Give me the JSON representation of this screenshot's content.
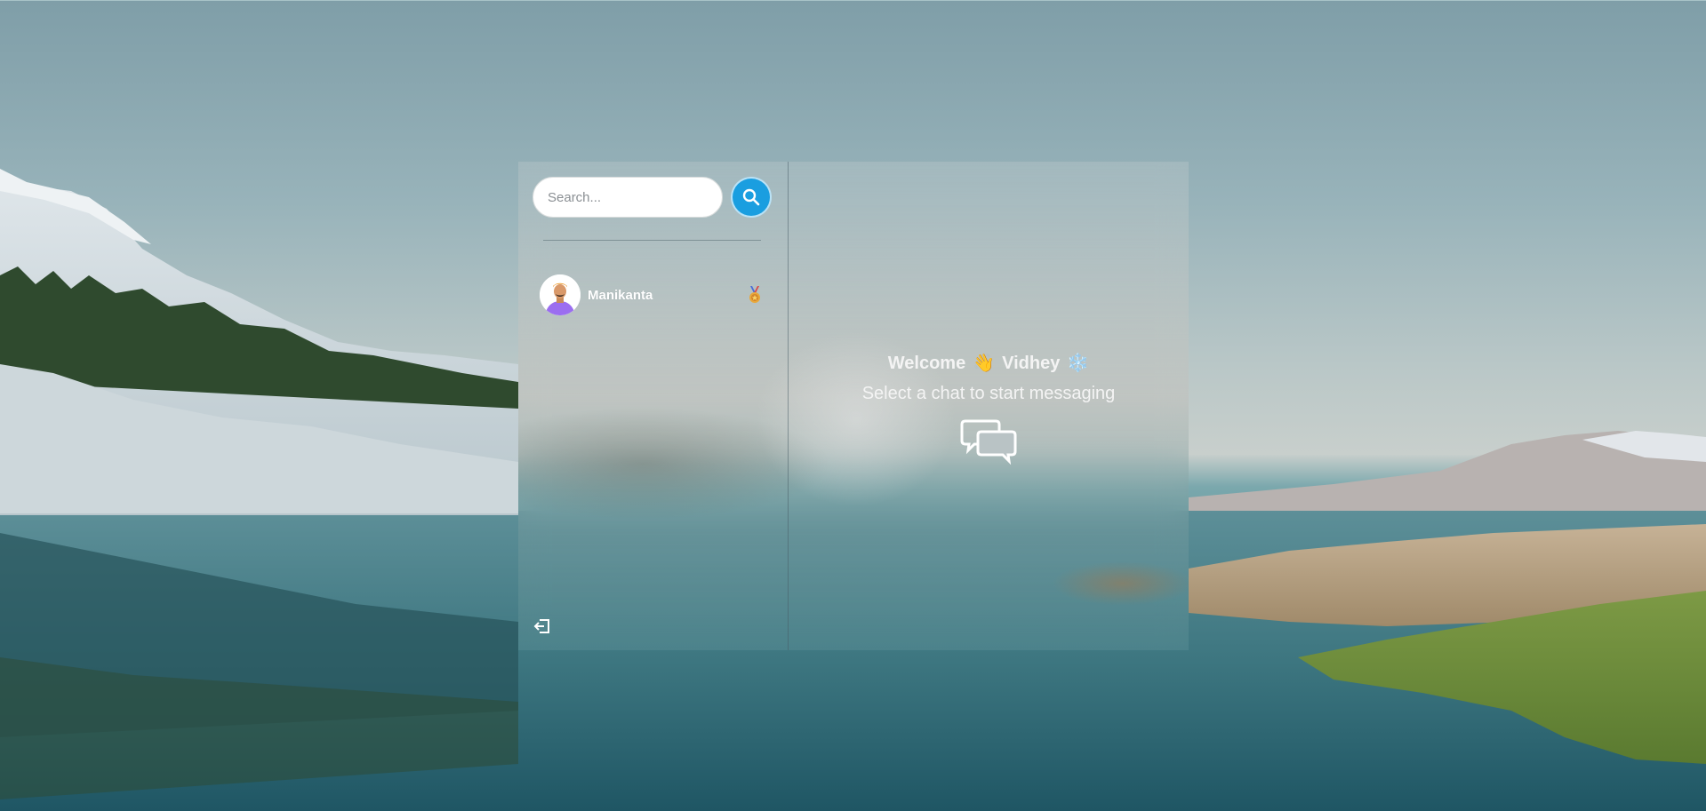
{
  "sidebar": {
    "search": {
      "placeholder": "Search...",
      "value": ""
    },
    "search_button_icon": "search-icon",
    "chats": [
      {
        "name": "Manikanta",
        "avatar": "avatar-illustration",
        "badge_icon": "medal-icon"
      }
    ],
    "logout_icon": "logout-icon"
  },
  "main": {
    "welcome": {
      "prefix": "Welcome",
      "wave_emoji": "👋",
      "user_name": "Vidhey",
      "trailing_emoji": "❄️"
    },
    "subtitle": "Select a chat to start messaging",
    "empty_icon": "chat-bubbles-icon"
  },
  "colors": {
    "accent": "#1a9ee0",
    "text_light": "#f4f4f4",
    "divider": "#46606a"
  }
}
